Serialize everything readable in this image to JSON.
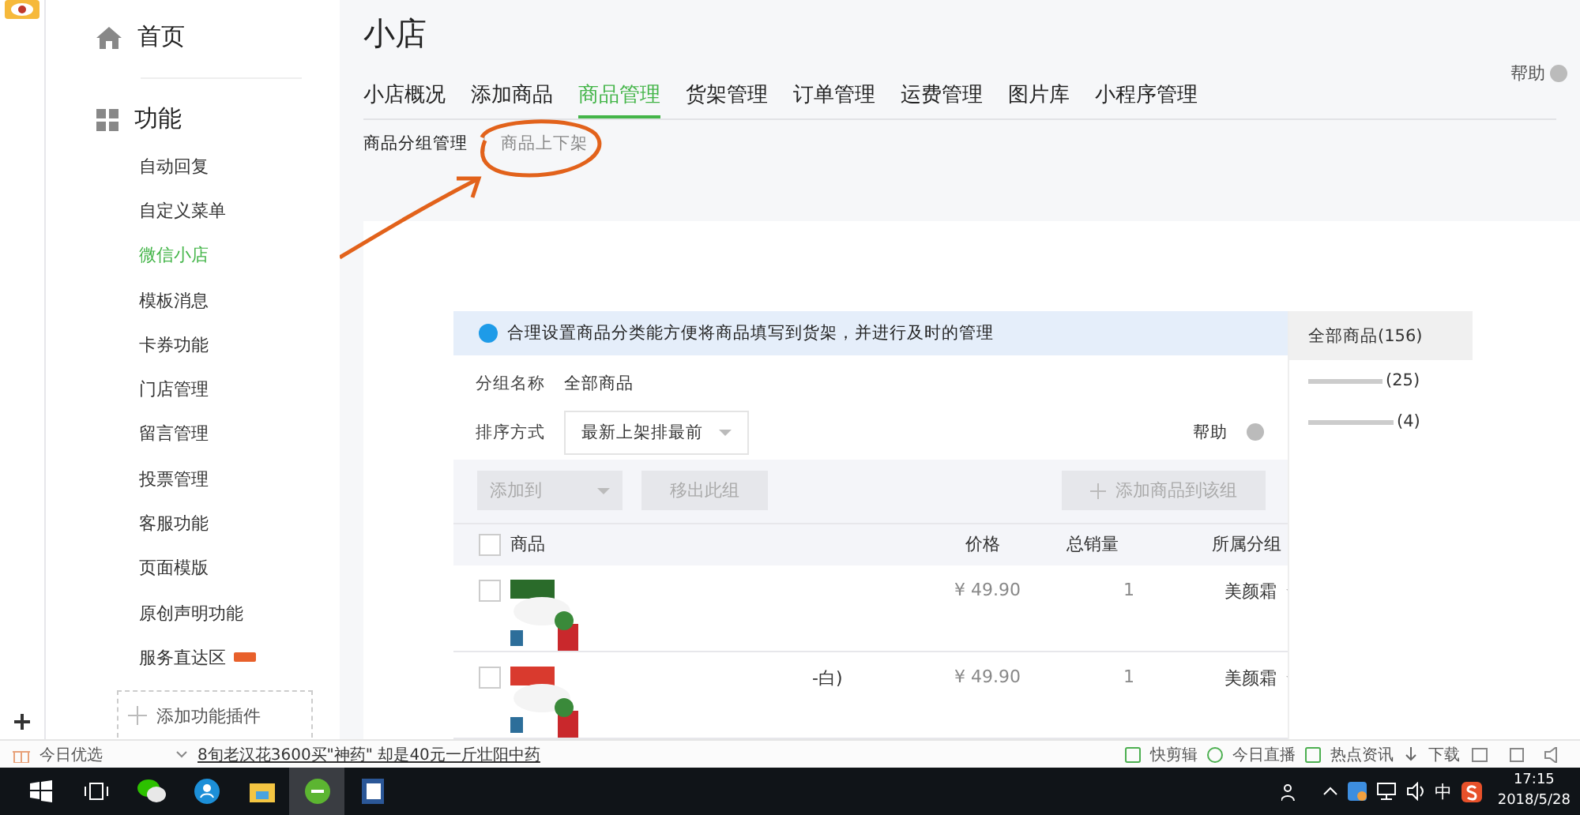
{
  "sidebar": {
    "home": "首页",
    "section": "功能",
    "items": [
      {
        "label": "自动回复",
        "selected": false
      },
      {
        "label": "自定义菜单",
        "selected": false
      },
      {
        "label": "微信小店",
        "selected": true
      },
      {
        "label": "模板消息",
        "selected": false
      },
      {
        "label": "卡券功能",
        "selected": false
      },
      {
        "label": "门店管理",
        "selected": false
      },
      {
        "label": "留言管理",
        "selected": false
      },
      {
        "label": "投票管理",
        "selected": false
      },
      {
        "label": "客服功能",
        "selected": false
      },
      {
        "label": "页面模版",
        "selected": false
      },
      {
        "label": "原创声明功能",
        "selected": false
      },
      {
        "label": "服务直达区",
        "selected": false,
        "badge": true
      }
    ],
    "add_plugin": "添加功能插件"
  },
  "page": {
    "title": "小店",
    "help": "帮助",
    "tabs": [
      {
        "label": "小店概况",
        "selected": false
      },
      {
        "label": "添加商品",
        "selected": false
      },
      {
        "label": "商品管理",
        "selected": true
      },
      {
        "label": "货架管理",
        "selected": false
      },
      {
        "label": "订单管理",
        "selected": false
      },
      {
        "label": "运费管理",
        "selected": false
      },
      {
        "label": "图片库",
        "selected": false
      },
      {
        "label": "小程序管理",
        "selected": false
      }
    ],
    "subtabs": [
      {
        "label": "商品分组管理",
        "selected": true
      },
      {
        "label": "商品上下架",
        "selected": false
      }
    ]
  },
  "panel": {
    "notice": "合理设置商品分类能方便将商品填写到货架，并进行及时的管理",
    "group_label": "分组名称",
    "group_value": "全部商品",
    "sort_label": "排序方式",
    "sort_value": "最新上架排最前",
    "help": "帮助",
    "buttons": [
      {
        "label": "添加到",
        "kind": "dropdown",
        "disabled": true
      },
      {
        "label": "移出此组",
        "kind": "plain",
        "disabled": true
      },
      {
        "label": "添加商品到该组",
        "kind": "add",
        "disabled": true
      }
    ],
    "all_checked": false,
    "columns": [
      "商品",
      "价格",
      "总销量",
      "所属分组"
    ],
    "rows": [
      {
        "checked": false,
        "price": "¥ 49.90",
        "sales": "1",
        "group": "美颜霜"
      },
      {
        "checked": false,
        "name": "-白)",
        "price": "¥ 49.90",
        "sales": "1",
        "group": "美颜霜"
      }
    ],
    "groups": [
      {
        "label": "全部商品(156)",
        "selected": true
      },
      {
        "label": "(25)",
        "selected": false
      },
      {
        "label": "(4)",
        "selected": false
      }
    ]
  },
  "status_bar": {
    "today": "今日优选",
    "headline": "8旬老汉花3600买\"神药\" 却是40元一斤壮阳中药",
    "tools": [
      "快剪辑",
      "今日直播",
      "热点资讯",
      "下载"
    ]
  },
  "taskbar": {
    "time": "17:15",
    "date": "2018/5/28",
    "ime": "中"
  }
}
